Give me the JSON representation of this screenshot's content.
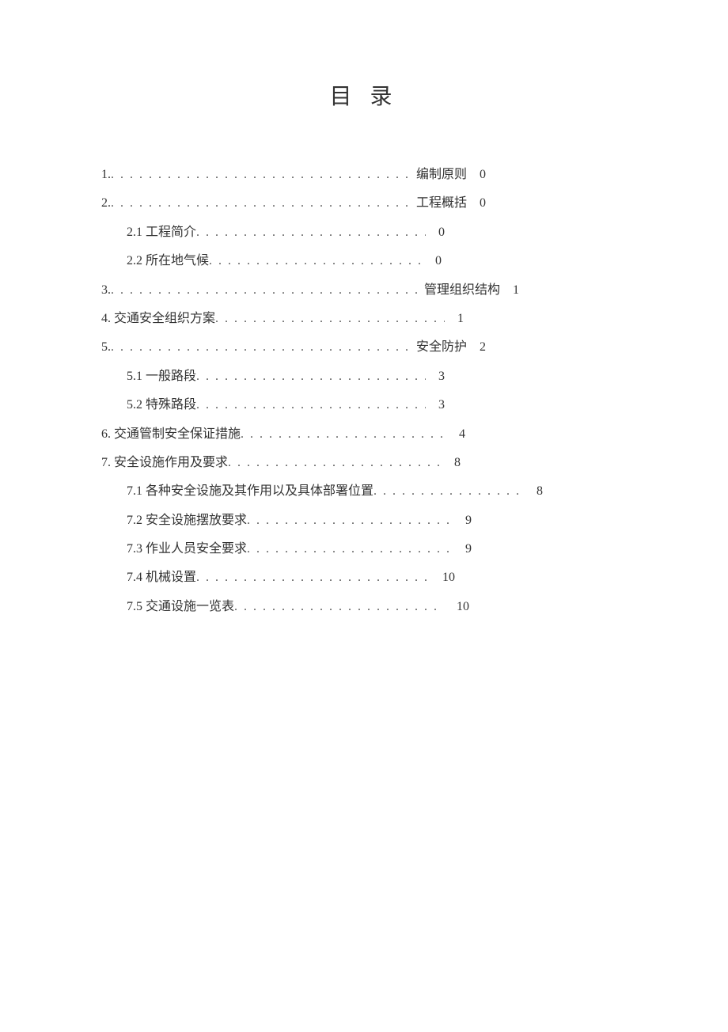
{
  "title": "目 录",
  "entries": [
    {
      "level": 1,
      "prefix": "1.",
      "after": "编制原则",
      "page": "0",
      "leaderWidth": "380px"
    },
    {
      "level": 1,
      "prefix": "2.",
      "after": "工程概括",
      "page": "0",
      "leaderWidth": "380px"
    },
    {
      "level": 2,
      "prefix": "2.1  工程简介",
      "after": "",
      "page": "0",
      "leaderWidth": "290px"
    },
    {
      "level": 2,
      "prefix": "2.2  所在地气候",
      "after": "",
      "page": "0",
      "leaderWidth": "270px"
    },
    {
      "level": 1,
      "prefix": "3.",
      "after": "管理组织结构",
      "page": "1",
      "leaderWidth": "390px"
    },
    {
      "level": 1,
      "prefix": "4.  交通安全组织方案",
      "after": "",
      "page": "1",
      "leaderWidth": "290px"
    },
    {
      "level": 1,
      "prefix": "5.",
      "after": "安全防护",
      "page": "2",
      "leaderWidth": "380px"
    },
    {
      "level": 2,
      "prefix": "5.1  一般路段",
      "after": "",
      "page": "3",
      "leaderWidth": "290px"
    },
    {
      "level": 2,
      "prefix": "5.2  特殊路段",
      "after": "",
      "page": "3",
      "leaderWidth": "290px"
    },
    {
      "level": 1,
      "prefix": "6.  交通管制安全保证措施",
      "after": "",
      "page": "4",
      "leaderWidth": "260px"
    },
    {
      "level": 1,
      "prefix": "7.  安全设施作用及要求",
      "after": "",
      "page": "8",
      "leaderWidth": "270px"
    },
    {
      "level": 2,
      "prefix": "7.1  各种安全设施及其作用以及具体部署位置",
      "after": "",
      "page": "8",
      "leaderWidth": "190px"
    },
    {
      "level": 2,
      "prefix": "7.2  安全设施摆放要求",
      "after": "",
      "page": "9",
      "leaderWidth": "260px"
    },
    {
      "level": 2,
      "prefix": "7.3  作业人员安全要求",
      "after": "",
      "page": "9",
      "leaderWidth": "260px"
    },
    {
      "level": 2,
      "prefix": "7.4  机械设置",
      "after": "",
      "page": "10",
      "leaderWidth": "295px"
    },
    {
      "level": 2,
      "prefix": "7.5  交通设施一览表",
      "after": "",
      "page": "10",
      "leaderWidth": "265px"
    }
  ],
  "leader": ". . . . . . . . . . . . . . . . . . . . . . . . . . . . . . . . . . . . . . . . . . . . . . . . . . . . . . . . . . . . . . . . . . . . . . . . . . . . . . . . . . . . . . . . . . . . . . . . . . . ."
}
